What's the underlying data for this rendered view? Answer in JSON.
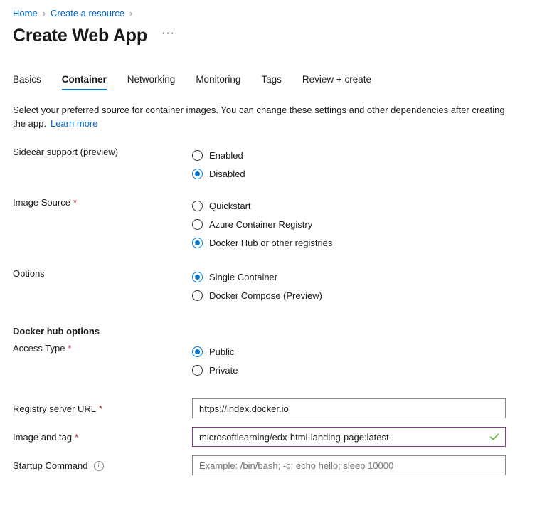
{
  "breadcrumb": {
    "items": [
      {
        "label": "Home"
      },
      {
        "label": "Create a resource"
      }
    ],
    "separator": "›"
  },
  "header": {
    "title": "Create Web App",
    "more_menu": "···"
  },
  "tabs": [
    {
      "label": "Basics",
      "active": false
    },
    {
      "label": "Container",
      "active": true
    },
    {
      "label": "Networking",
      "active": false
    },
    {
      "label": "Monitoring",
      "active": false
    },
    {
      "label": "Tags",
      "active": false
    },
    {
      "label": "Review + create",
      "active": false
    }
  ],
  "description": {
    "text": "Select your preferred source for container images. You can change these settings and other dependencies after creating the app.",
    "link_label": "Learn more"
  },
  "fields": {
    "sidecar": {
      "label": "Sidecar support (preview)",
      "required": false,
      "options": [
        {
          "label": "Enabled",
          "selected": false
        },
        {
          "label": "Disabled",
          "selected": true
        }
      ]
    },
    "image_source": {
      "label": "Image Source",
      "required": true,
      "options": [
        {
          "label": "Quickstart",
          "selected": false
        },
        {
          "label": "Azure Container Registry",
          "selected": false
        },
        {
          "label": "Docker Hub or other registries",
          "selected": true
        }
      ]
    },
    "options": {
      "label": "Options",
      "required": false,
      "options": [
        {
          "label": "Single Container",
          "selected": true
        },
        {
          "label": "Docker Compose (Preview)",
          "selected": false
        }
      ]
    },
    "docker_hub_section_title": "Docker hub options",
    "access_type": {
      "label": "Access Type",
      "required": true,
      "options": [
        {
          "label": "Public",
          "selected": true
        },
        {
          "label": "Private",
          "selected": false
        }
      ]
    },
    "registry_server_url": {
      "label": "Registry server URL",
      "required": true,
      "value": "https://index.docker.io",
      "placeholder": ""
    },
    "image_and_tag": {
      "label": "Image and tag",
      "required": true,
      "value": "microsoftlearning/edx-html-landing-page:latest",
      "placeholder": "",
      "validated": true
    },
    "startup_command": {
      "label": "Startup Command",
      "required": false,
      "value": "",
      "placeholder": "Example: /bin/bash; -c; echo hello; sleep 10000",
      "info_glyph": "i"
    }
  },
  "colors": {
    "accent": "#0078d4",
    "link": "#0066cc",
    "required_asterisk": "#a4262c",
    "validated_border": "#8a3b8f",
    "success_check": "#5ab52e"
  }
}
